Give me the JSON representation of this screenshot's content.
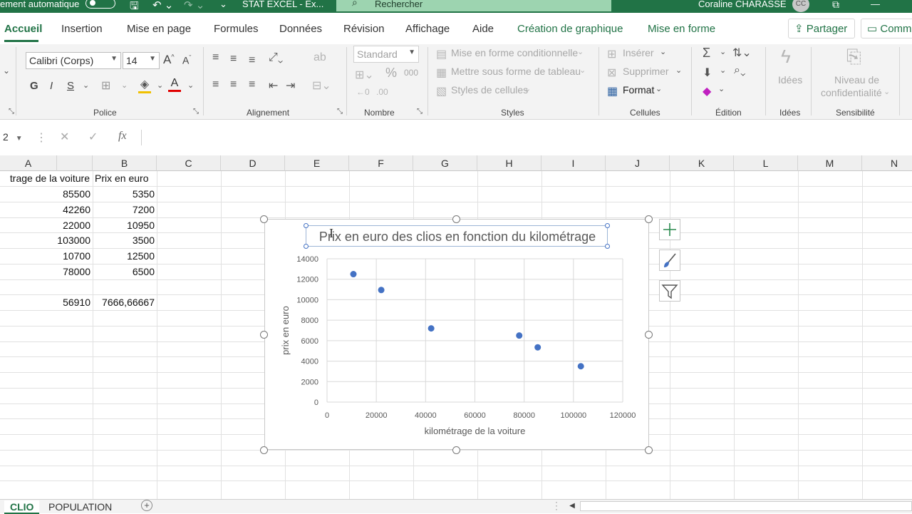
{
  "titlebar": {
    "autosave_label": "ement automatique",
    "file_name": "STAT EXCEL - Ex...",
    "search_placeholder": "Rechercher",
    "user_name": "Coraline CHARASSE",
    "user_initials": "CC"
  },
  "tabs": [
    {
      "label": "Accueil",
      "active": true
    },
    {
      "label": "Insertion"
    },
    {
      "label": "Mise en page"
    },
    {
      "label": "Formules"
    },
    {
      "label": "Données"
    },
    {
      "label": "Révision"
    },
    {
      "label": "Affichage"
    },
    {
      "label": "Aide"
    },
    {
      "label": "Création de graphique"
    },
    {
      "label": "Mise en forme"
    }
  ],
  "share_label": "Partager",
  "comments_label": "Comm",
  "ribbon": {
    "font_name": "Calibri (Corps)",
    "font_size": "14",
    "bold": "G",
    "italic": "I",
    "underline": "S",
    "number_format": "Standard",
    "percent": "%",
    "thousands": "000",
    "cond_format": "Mise en forme conditionnelle",
    "table_format": "Mettre sous forme de tableau",
    "cell_styles": "Styles de cellules",
    "insert": "Insérer",
    "delete": "Supprimer",
    "format": "Format",
    "ideas": "Idées",
    "sensitivity_l1": "Niveau de",
    "sensitivity_l2": "confidentialité",
    "groups": {
      "police": "Police",
      "alignement": "Alignement",
      "nombre": "Nombre",
      "styles": "Styles",
      "cellules": "Cellules",
      "edition": "Édition",
      "idees": "Idées",
      "sensibilite": "Sensibilité"
    }
  },
  "formula_bar": {
    "name_box": "2",
    "fx": "fx"
  },
  "columns": [
    "A",
    "B",
    "C",
    "D",
    "E",
    "F",
    "G",
    "H",
    "I",
    "J",
    "K",
    "L",
    "M",
    "N"
  ],
  "table": {
    "header_a": "trage de la voiture",
    "header_b": "Prix en euro",
    "rows": [
      [
        "85500",
        "5350"
      ],
      [
        "42260",
        "7200"
      ],
      [
        "22000",
        "10950"
      ],
      [
        "103000",
        "3500"
      ],
      [
        "10700",
        "12500"
      ],
      [
        "78000",
        "6500"
      ]
    ],
    "mean_a": "56910",
    "mean_b": "7666,66667"
  },
  "chart_data": {
    "type": "scatter",
    "title": "Prix en euro des clios en fonction du kilométrage",
    "xlabel": "kilométrage de la voiture",
    "ylabel": "prix en euro",
    "xlim": [
      0,
      120000
    ],
    "ylim": [
      0,
      14000
    ],
    "x_ticks": [
      "0",
      "20000",
      "40000",
      "60000",
      "80000",
      "100000",
      "120000"
    ],
    "y_ticks": [
      "0",
      "2000",
      "4000",
      "6000",
      "8000",
      "10000",
      "12000",
      "14000"
    ],
    "grid": true,
    "color": "#4472c4",
    "x": [
      85500,
      42260,
      22000,
      103000,
      10700,
      78000
    ],
    "y": [
      5350,
      7200,
      10950,
      3500,
      12500,
      6500
    ]
  },
  "sheets": [
    {
      "label": "CLIO",
      "active": true
    },
    {
      "label": "POPULATION"
    }
  ]
}
